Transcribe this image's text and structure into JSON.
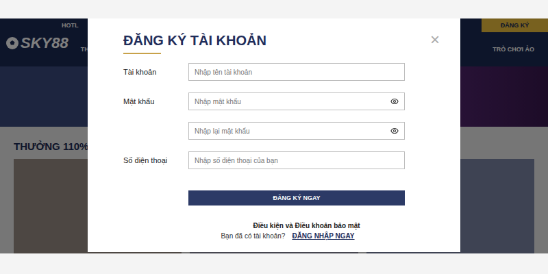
{
  "site": {
    "logo": "SKY88",
    "hotline": "HOTL",
    "nav": [
      "THỂ T",
      "TRÒ CHƠI ẢO"
    ],
    "register_button": "ĐĂNG KÝ",
    "section_title": "THƯỞNG 110%"
  },
  "modal": {
    "title": "ĐĂNG KÝ TÀI KHOẢN",
    "close": "×",
    "fields": [
      {
        "label": "Tài khoản",
        "placeholder": "Nhập tên tài khoản",
        "kind": "text"
      },
      {
        "label": "Mật khẩu",
        "placeholder": "Nhập mật khẩu",
        "kind": "password"
      },
      {
        "label": null,
        "placeholder": "Nhập lại mật khẩu",
        "kind": "password"
      },
      {
        "label": "Số điện thoại",
        "placeholder": "Nhập số điện thoại của bạn",
        "kind": "text"
      }
    ],
    "submit": "ĐĂNG KÝ NGAY",
    "terms": "Điều kiện và Điều khoản bảo mật",
    "login_prompt": "Bạn đã có tài khoản?",
    "login_link": "ĐĂNG NHẬP NGAY"
  }
}
